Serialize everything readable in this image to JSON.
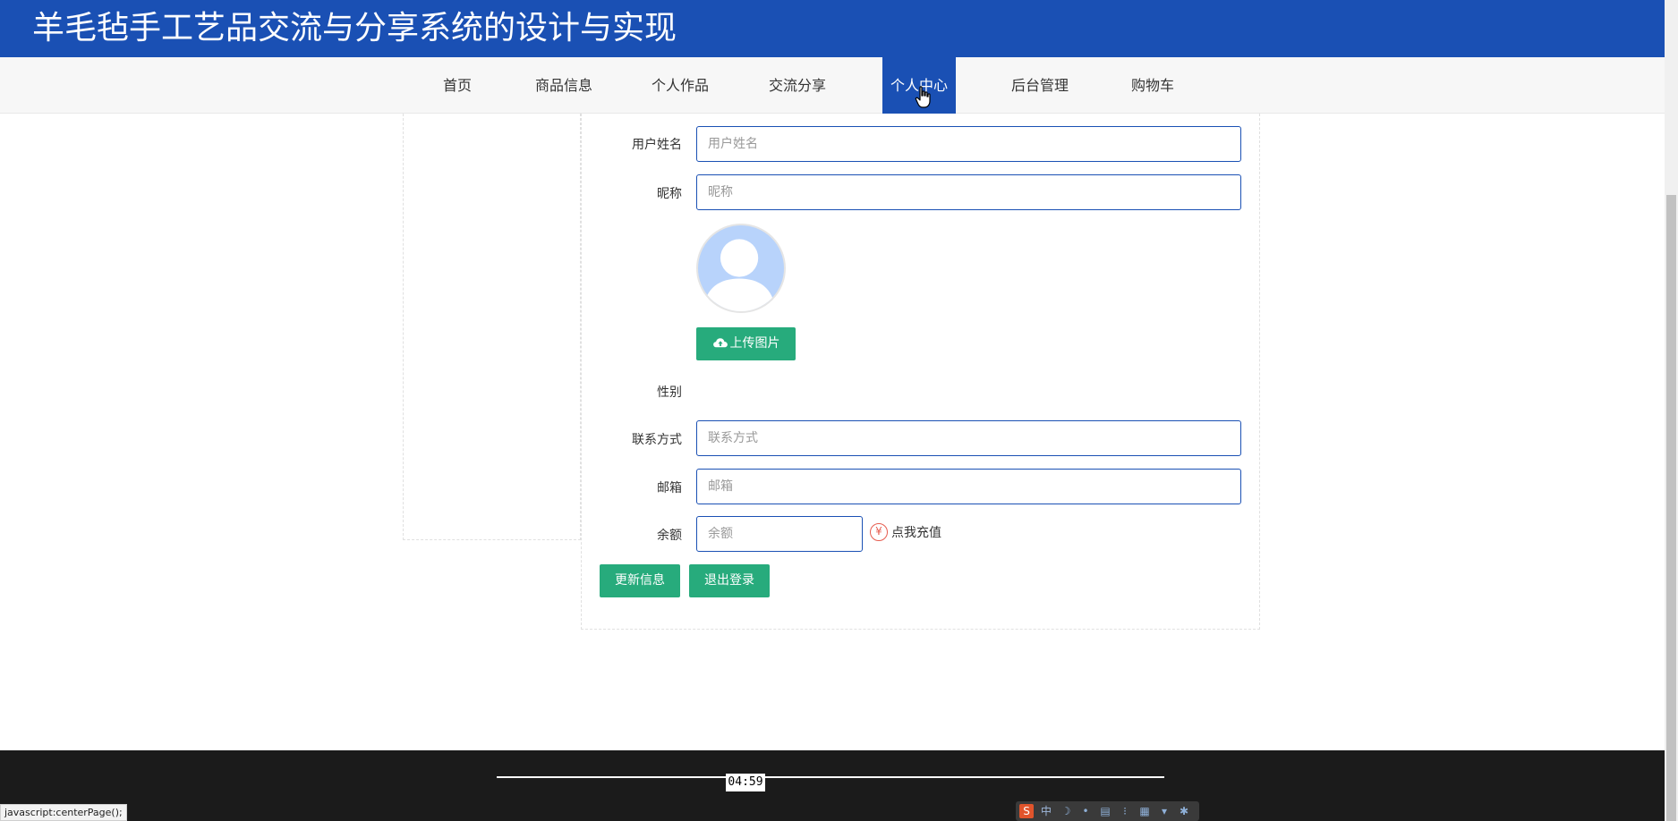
{
  "header": {
    "title": "羊毛毡手工艺品交流与分享系统的设计与实现"
  },
  "nav": {
    "items": [
      {
        "label": "首页"
      },
      {
        "label": "商品信息"
      },
      {
        "label": "个人作品"
      },
      {
        "label": "交流分享"
      },
      {
        "label": "个人中心",
        "active": true
      },
      {
        "label": "后台管理"
      },
      {
        "label": "购物车"
      }
    ]
  },
  "form": {
    "username": {
      "label": "用户姓名",
      "placeholder": "用户姓名",
      "value": ""
    },
    "nickname": {
      "label": "昵称",
      "placeholder": "昵称",
      "value": ""
    },
    "upload_label": "上传图片",
    "gender": {
      "label": "性别"
    },
    "contact": {
      "label": "联系方式",
      "placeholder": "联系方式",
      "value": ""
    },
    "email": {
      "label": "邮箱",
      "placeholder": "邮箱",
      "value": ""
    },
    "balance": {
      "label": "余额",
      "placeholder": "余额",
      "value": ""
    },
    "recharge_label": "点我充值",
    "recharge_icon_glyph": "¥",
    "update_label": "更新信息",
    "logout_label": "退出登录"
  },
  "player": {
    "time": "04:59"
  },
  "status_bar": {
    "url": "javascript:centerPage();"
  },
  "ime_toolbar": {
    "glyphs": [
      "中"
    ]
  },
  "colors": {
    "primary": "#1a50b4",
    "success": "#27ab7c",
    "avatar_bg": "#b8d3fb",
    "recharge_icon": "#e65c4f"
  }
}
